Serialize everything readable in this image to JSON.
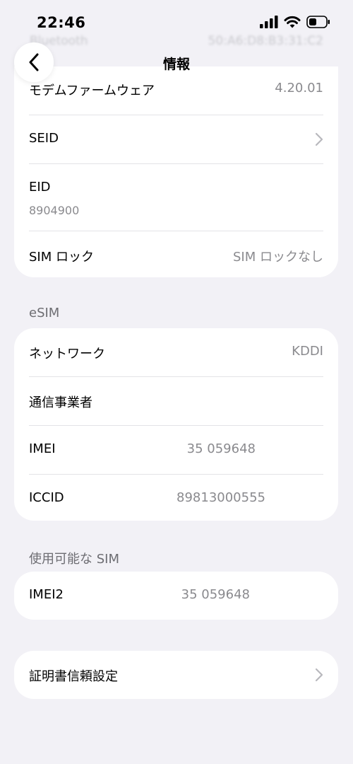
{
  "status_bar": {
    "time": "22:46"
  },
  "ghost_row": {
    "label": "Bluetooth",
    "value": "50:A6:D8:B3:31:C2"
  },
  "nav": {
    "title": "情報"
  },
  "card1": {
    "modem_label": "モデムファームウェア",
    "modem_value": "4.20.01",
    "seid_label": "SEID",
    "eid_label": "EID",
    "eid_value": "8904900",
    "simlock_label": "SIM ロック",
    "simlock_value": "SIM ロックなし"
  },
  "esim_section": {
    "title": "eSIM"
  },
  "card2": {
    "network_label": "ネットワーク",
    "network_value": "KDDI",
    "carrier_label": "通信事業者",
    "imei_label": "IMEI",
    "imei_value": "35 059648",
    "iccid_label": "ICCID",
    "iccid_value": "89813000555"
  },
  "available_section": {
    "title": "使用可能な SIM"
  },
  "card3": {
    "imei2_label": "IMEI2",
    "imei2_value": "35 059648"
  },
  "card4": {
    "cert_label": "証明書信頼設定"
  }
}
